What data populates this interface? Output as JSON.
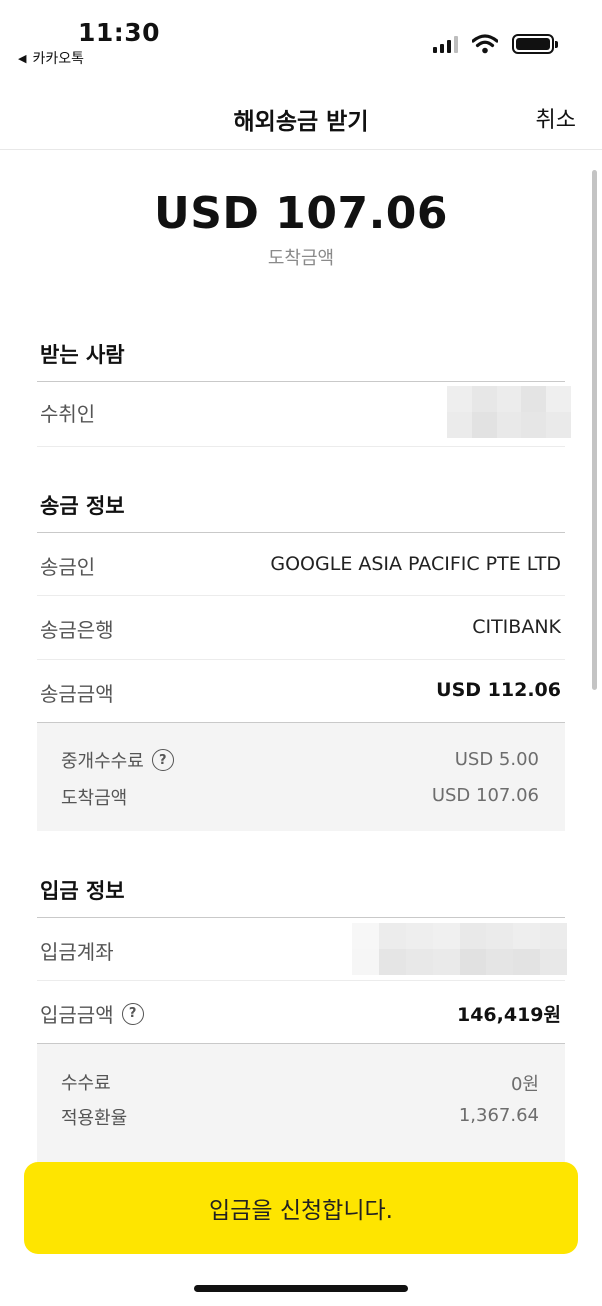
{
  "status_bar": {
    "time": "11:30",
    "back_app": "카카오톡",
    "back_icon": "triangle-left",
    "signal_icon": "cellular-signal",
    "wifi_icon": "wifi",
    "battery_icon": "battery-full"
  },
  "header": {
    "title": "해외송금 받기",
    "cancel_label": "취소"
  },
  "hero": {
    "amount": "USD 107.06",
    "label": "도착금액"
  },
  "recipient": {
    "title": "받는 사람",
    "name_label": "수취인"
  },
  "remittance": {
    "title": "송금 정보",
    "sender_label": "송금인",
    "sender_value": "GOOGLE ASIA PACIFIC PTE LTD",
    "bank_label": "송금은행",
    "bank_value": "CITIBANK",
    "amount_label": "송금금액",
    "amount_value": "USD 112.06",
    "breakdown": {
      "fee_label": "중개수수료",
      "fee_value": "USD 5.00",
      "arrival_label": "도착금액",
      "arrival_value": "USD 107.06"
    }
  },
  "deposit": {
    "title": "입금 정보",
    "account_label": "입금계좌",
    "amount_label": "입금금액",
    "amount_value": "146,419원",
    "breakdown": {
      "fee_label": "수수료",
      "fee_value": "0원",
      "rate_label": "적용환율",
      "rate_value": "1,367.64"
    }
  },
  "help_icon_glyph": "?",
  "cta": {
    "label": "입금을 신청합니다.",
    "color": "#FEE500"
  }
}
